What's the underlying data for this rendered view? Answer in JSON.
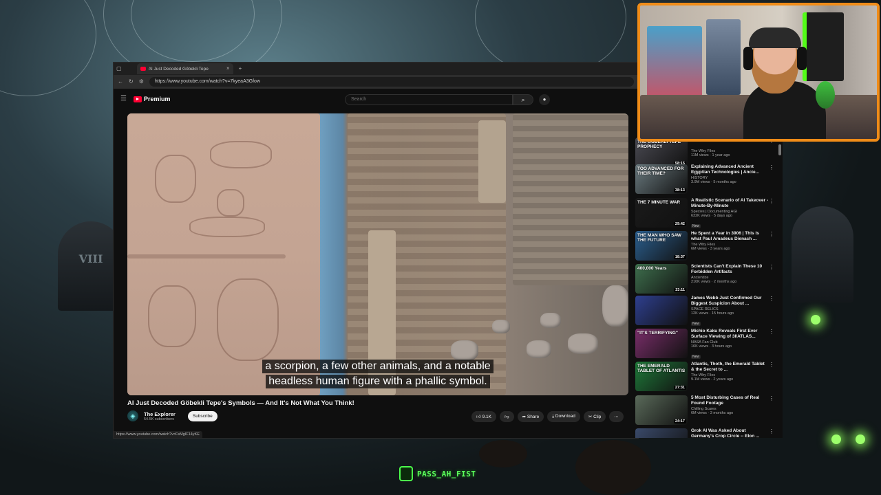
{
  "browser": {
    "tab_title": "AI Just Decoded Göbekli Tepe",
    "url": "https://www.youtube.com/watch?v=7kyeaA3Gfow",
    "status_url": "https://www.youtube.com/watch?v=FsMgIF14yKE"
  },
  "youtube": {
    "logo": "Premium",
    "search_placeholder": "Search"
  },
  "video": {
    "caption_line1": "a scorpion, a few other animals, and a notable",
    "caption_line2": "headless human figure with a phallic symbol.",
    "title": "AI Just Decoded Göbekli Tepe's Symbols — And It's Not What You Think!",
    "channel": "The Explorer",
    "subscribers": "54.5K subscribers",
    "subscribe_label": "Subscribe",
    "likes": "9.1K",
    "share_label": "Share",
    "download_label": "Download",
    "clip_label": "Clip"
  },
  "sidebar": {
    "items": [
      {
        "thumb_text": "THE GOBEKLI TEPE PROPHECY",
        "duration": "58:15",
        "title": "",
        "channel": "The Why Files",
        "stats": "11M views · 1 year ago",
        "badge": "",
        "thumb_color": "#4a4a52"
      },
      {
        "thumb_text": "TOO ADVANCED FOR THEIR TIME?",
        "duration": "38:13",
        "title": "Explaining Advanced Ancient Egyptian Technologies | Ancie...",
        "channel": "HISTORY",
        "stats": "3.9M views · 5 months ago",
        "badge": "",
        "thumb_color": "#6a7a7f"
      },
      {
        "thumb_text": "THE 7 MINUTE WAR",
        "duration": "29:42",
        "title": "A Realistic Scenario of AI Takeover - Minute-By-Minute",
        "channel": "Species | Documenting AGI",
        "stats": "632K views · 5 days ago",
        "badge": "New",
        "thumb_color": "#1a1a1a"
      },
      {
        "thumb_text": "THE MAN WHO SAW THE FUTURE",
        "duration": "18:37",
        "title": "He Spent a Year in 3906 | This Is what Paul Amadeus Dienach ...",
        "channel": "The Why Files",
        "stats": "6M views · 3 years ago",
        "badge": "",
        "thumb_color": "#2b5f8f"
      },
      {
        "thumb_text": "400,000 Years",
        "duration": "23:11",
        "title": "Scientists Can't Explain These 10 Forbidden Artifacts",
        "channel": "Ancientize",
        "stats": "210K views · 2 months ago",
        "badge": "",
        "thumb_color": "#3e6f4d"
      },
      {
        "thumb_text": "",
        "duration": "",
        "title": "James Webb Just Confirmed Our Biggest Suspicion About ...",
        "channel": "SPACE RELICS",
        "stats": "12K views · 15 hours ago",
        "badge": "New",
        "thumb_color": "#2e3f8f"
      },
      {
        "thumb_text": "\"IT'S TERRIFYING\"",
        "duration": "",
        "title": "Michio Kaku Reveals First Ever Surface Viewing of 3I/ATLAS...",
        "channel": "NASA Fan Club",
        "stats": "16K views · 3 hours ago",
        "badge": "New",
        "thumb_color": "#7a2e6a"
      },
      {
        "thumb_text": "THE EMERALD TABLET OF ATLANTIS",
        "duration": "27:31",
        "title": "Atlantis, Thoth, the Emerald Tablet & the Secret to ...",
        "channel": "The Why Files",
        "stats": "9.1M views · 2 years ago",
        "badge": "",
        "thumb_color": "#1f7a3a"
      },
      {
        "thumb_text": "",
        "duration": "24:17",
        "title": "5 Most Disturbing Cases of Real Found Footage",
        "channel": "Chilling Scares",
        "stats": "6M views · 3 months ago",
        "badge": "",
        "thumb_color": "#5a6a5a"
      },
      {
        "thumb_text": "",
        "duration": "",
        "title": "Grok AI Was Asked About Germany's Crop Circle -- Elon ...",
        "channel": "",
        "stats": "",
        "badge": "",
        "thumb_color": "#3a4a6a"
      }
    ]
  },
  "overlay": {
    "brand": "PASS_AH_FIST"
  }
}
